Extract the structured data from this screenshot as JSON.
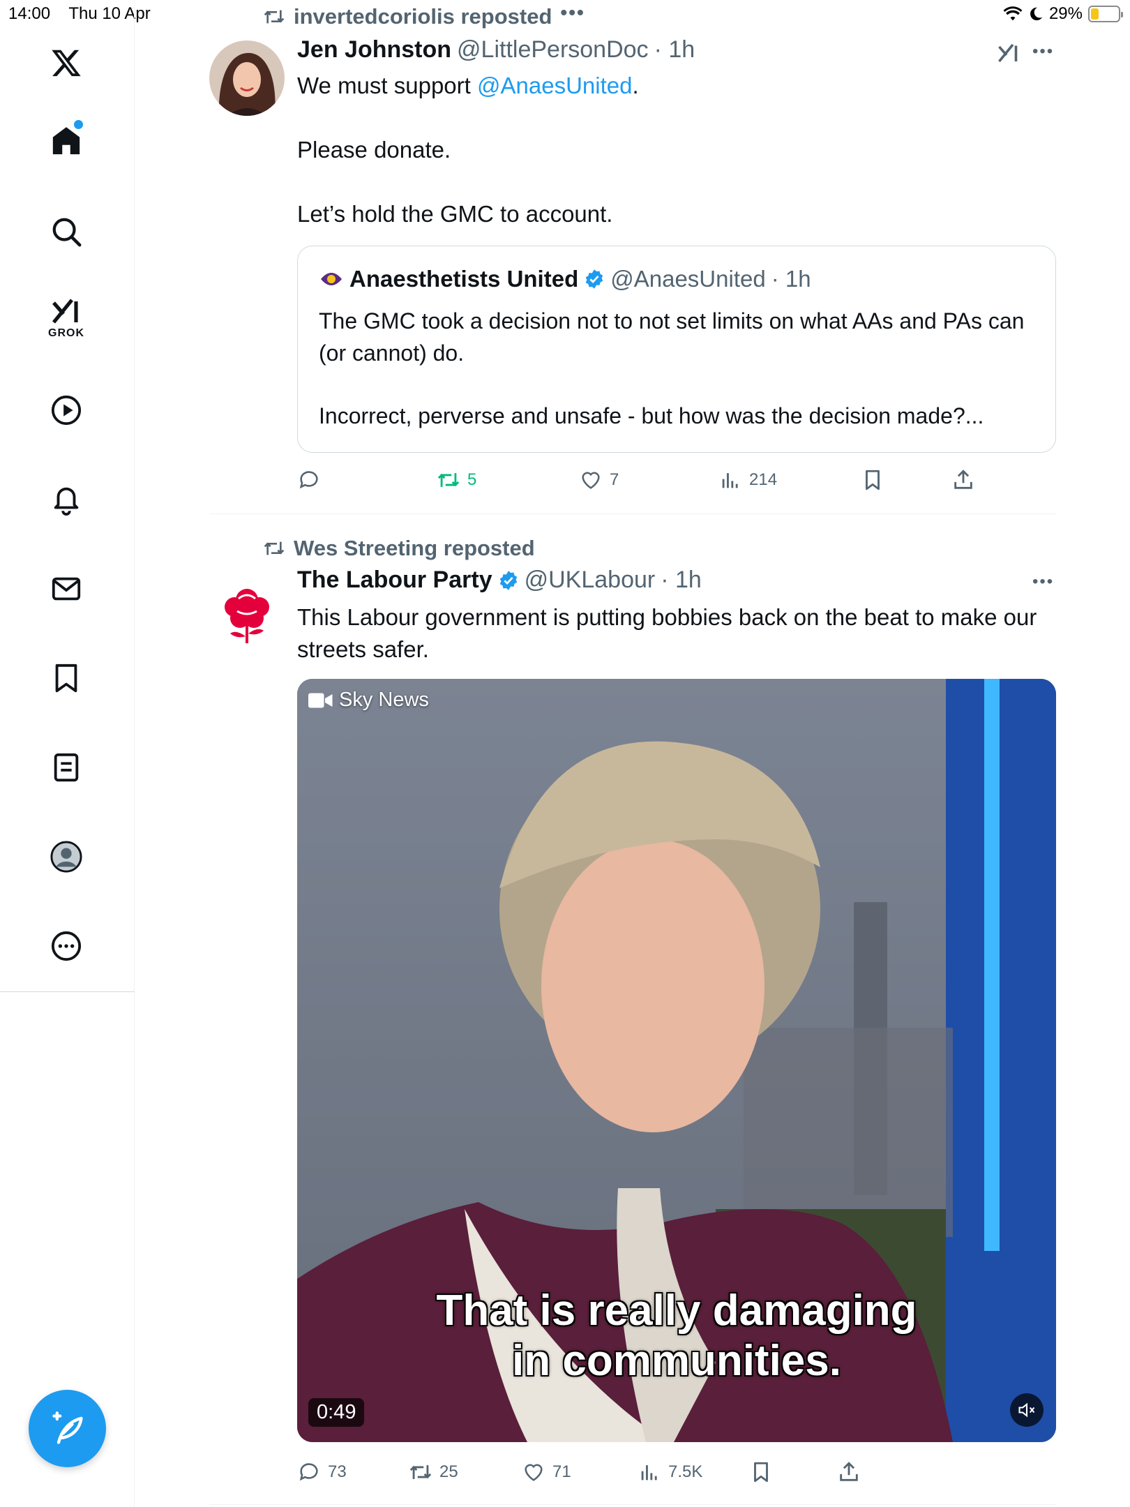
{
  "status_bar": {
    "time": "14:00",
    "date": "Thu 10 Apr",
    "battery": "29%",
    "battery_level": 0.29
  },
  "sidebar": {
    "items": [
      {
        "label": "X",
        "icon": "x-logo-icon"
      },
      {
        "label": "Home",
        "icon": "home-icon",
        "notification_dot": true
      },
      {
        "label": "Search",
        "icon": "search-icon"
      },
      {
        "label": "GROK",
        "icon": "grok-icon"
      },
      {
        "label": "Videos",
        "icon": "play-icon"
      },
      {
        "label": "Notifications",
        "icon": "bell-icon"
      },
      {
        "label": "Messages",
        "icon": "mail-icon"
      },
      {
        "label": "Bookmarks",
        "icon": "bookmark-icon"
      },
      {
        "label": "Lists",
        "icon": "list-icon"
      },
      {
        "label": "Profile",
        "icon": "profile-icon"
      },
      {
        "label": "More",
        "icon": "more-circle-icon"
      }
    ],
    "compose_icon": "compose-feather-icon"
  },
  "tweets": [
    {
      "repost_by": "invertedcoriolis reposted",
      "author": "Jen Johnston",
      "handle": "@LittlePersonDoc",
      "time": "· 1h",
      "text_line1_prefix": "We must support ",
      "text_line1_mention": "@AnaesUnited",
      "text_line1_suffix": ".",
      "text_line2": "Please donate.",
      "text_line3": "Let’s hold the GMC to account.",
      "quote": {
        "author": "Anaesthetists United",
        "handle": "@AnaesUnited",
        "time": "· 1h",
        "text1": "The GMC took a decision not to not set limits on what AAs and PAs can  (or cannot) do.",
        "text2": "Incorrect, perverse and unsafe - but how was the  decision made?..."
      },
      "actions": {
        "replies": "",
        "reposts": "5",
        "likes": "7",
        "views": "214"
      }
    },
    {
      "repost_by": "Wes Streeting reposted",
      "author": "The Labour Party",
      "handle": "@UKLabour",
      "time": "· 1h",
      "text": "This Labour government is putting bobbies back on the beat to make our streets safer.",
      "video": {
        "source": "Sky News",
        "caption_line1": "That is really damaging",
        "caption_line2": "in communities.",
        "duration": "0:49"
      },
      "actions": {
        "replies": "73",
        "reposts": "25",
        "likes": "71",
        "views": "7.5K"
      }
    }
  ],
  "colors": {
    "accent": "#1d9bf0",
    "repost_green": "#00ba7c",
    "muted": "#536471",
    "labour_red": "#e4003b"
  }
}
